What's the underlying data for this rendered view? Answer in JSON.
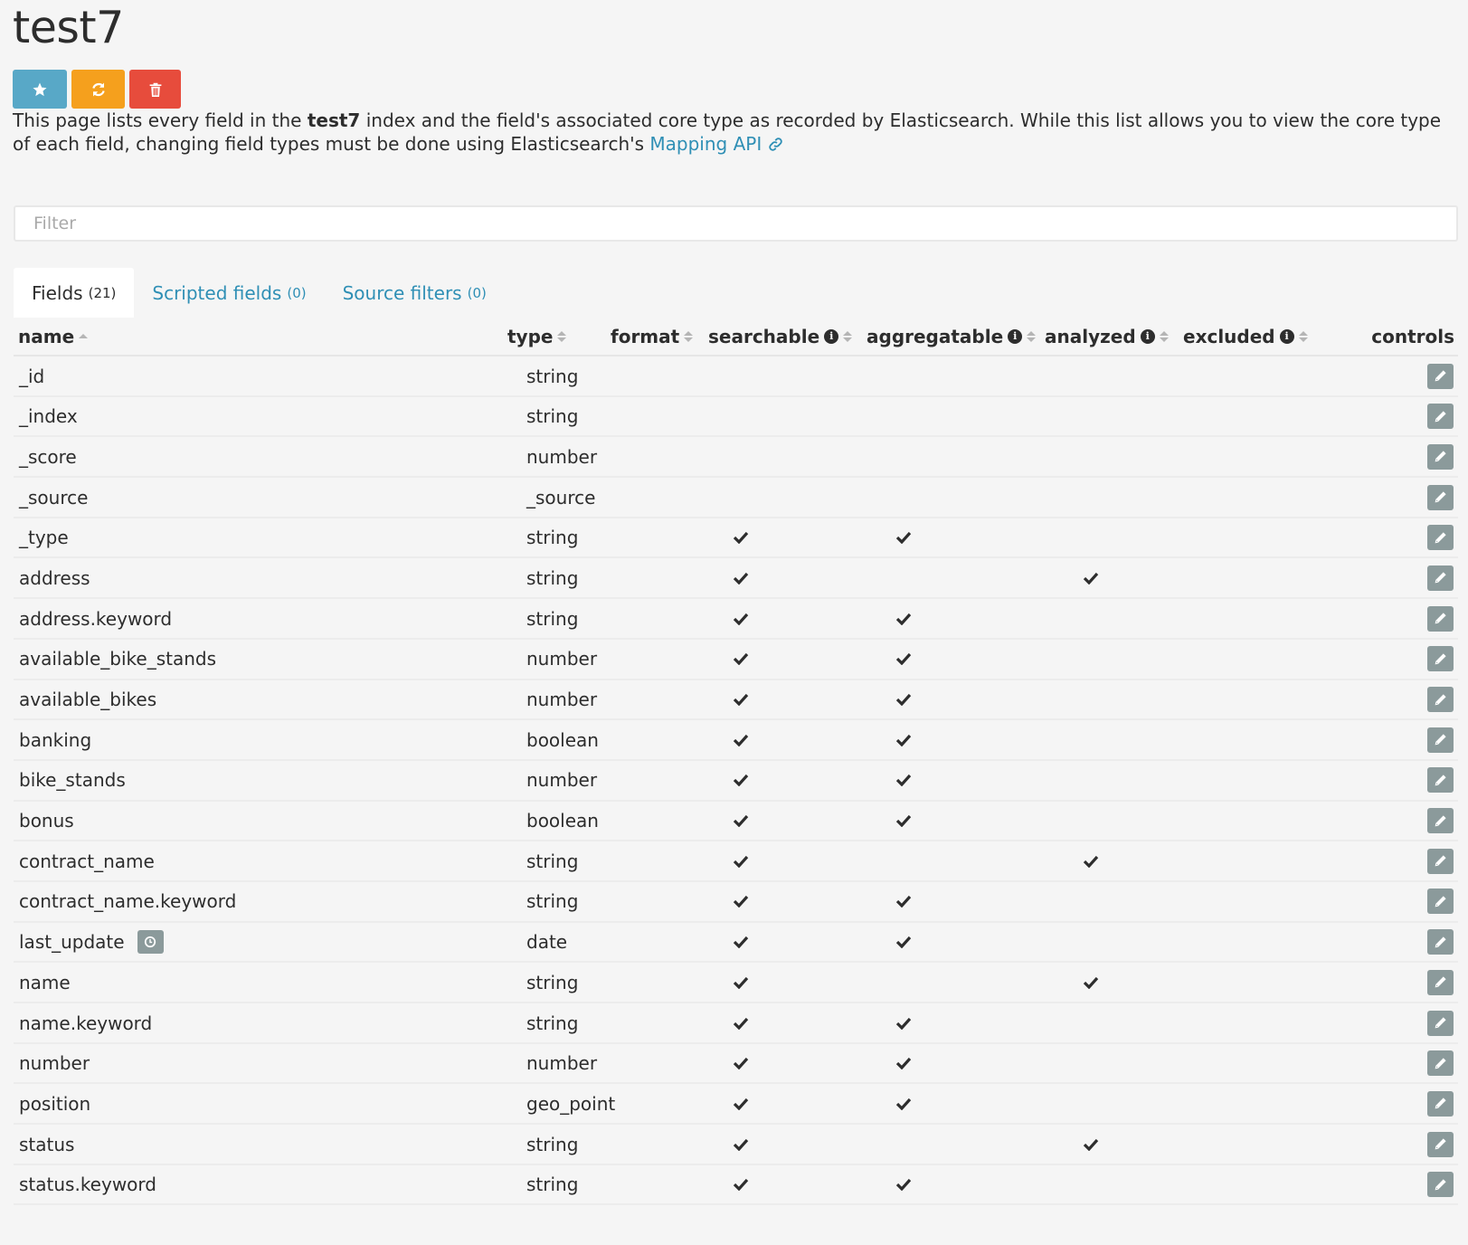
{
  "page": {
    "title": "test7",
    "description_pre": "This page lists every field in the ",
    "index_name": "test7",
    "description_post": " index and the field's associated core type as recorded by Elasticsearch. While this list allows you to view the core type of each field, changing field types must be done using Elasticsearch's ",
    "mapping_api_link": "Mapping API"
  },
  "actions": {
    "icons": [
      "star-icon",
      "refresh-icon",
      "trash-icon"
    ],
    "colors": {
      "favorite": "#58a8c7",
      "refresh": "#f5a01d",
      "delete": "#e74c3c"
    }
  },
  "filter": {
    "placeholder": "Filter",
    "value": ""
  },
  "tabs": [
    {
      "label": "Fields",
      "count": "(21)",
      "active": true
    },
    {
      "label": "Scripted fields",
      "count": "(0)",
      "active": false
    },
    {
      "label": "Source filters",
      "count": "(0)",
      "active": false
    }
  ],
  "columns": {
    "name": "name",
    "type": "type",
    "format": "format",
    "searchable": "searchable",
    "aggregatable": "aggregatable",
    "analyzed": "analyzed",
    "excluded": "excluded",
    "controls": "controls",
    "sorted_by": "name",
    "sort_direction": "asc"
  },
  "rows": [
    {
      "name": "_id",
      "type": "string",
      "searchable": false,
      "aggregatable": false,
      "analyzed": false
    },
    {
      "name": "_index",
      "type": "string",
      "searchable": false,
      "aggregatable": false,
      "analyzed": false
    },
    {
      "name": "_score",
      "type": "number",
      "searchable": false,
      "aggregatable": false,
      "analyzed": false
    },
    {
      "name": "_source",
      "type": "_source",
      "searchable": false,
      "aggregatable": false,
      "analyzed": false
    },
    {
      "name": "_type",
      "type": "string",
      "searchable": true,
      "aggregatable": true,
      "analyzed": false
    },
    {
      "name": "address",
      "type": "string",
      "searchable": true,
      "aggregatable": false,
      "analyzed": true
    },
    {
      "name": "address.keyword",
      "type": "string",
      "searchable": true,
      "aggregatable": true,
      "analyzed": false
    },
    {
      "name": "available_bike_stands",
      "type": "number",
      "searchable": true,
      "aggregatable": true,
      "analyzed": false
    },
    {
      "name": "available_bikes",
      "type": "number",
      "searchable": true,
      "aggregatable": true,
      "analyzed": false
    },
    {
      "name": "banking",
      "type": "boolean",
      "searchable": true,
      "aggregatable": true,
      "analyzed": false
    },
    {
      "name": "bike_stands",
      "type": "number",
      "searchable": true,
      "aggregatable": true,
      "analyzed": false
    },
    {
      "name": "bonus",
      "type": "boolean",
      "searchable": true,
      "aggregatable": true,
      "analyzed": false
    },
    {
      "name": "contract_name",
      "type": "string",
      "searchable": true,
      "aggregatable": false,
      "analyzed": true
    },
    {
      "name": "contract_name.keyword",
      "type": "string",
      "searchable": true,
      "aggregatable": true,
      "analyzed": false
    },
    {
      "name": "last_update",
      "type": "date",
      "searchable": true,
      "aggregatable": true,
      "analyzed": false,
      "time_field": true
    },
    {
      "name": "name",
      "type": "string",
      "searchable": true,
      "aggregatable": false,
      "analyzed": true
    },
    {
      "name": "name.keyword",
      "type": "string",
      "searchable": true,
      "aggregatable": true,
      "analyzed": false
    },
    {
      "name": "number",
      "type": "number",
      "searchable": true,
      "aggregatable": true,
      "analyzed": false
    },
    {
      "name": "position",
      "type": "geo_point",
      "searchable": true,
      "aggregatable": true,
      "analyzed": false
    },
    {
      "name": "status",
      "type": "string",
      "searchable": true,
      "aggregatable": false,
      "analyzed": true
    },
    {
      "name": "status.keyword",
      "type": "string",
      "searchable": true,
      "aggregatable": true,
      "analyzed": false
    }
  ]
}
